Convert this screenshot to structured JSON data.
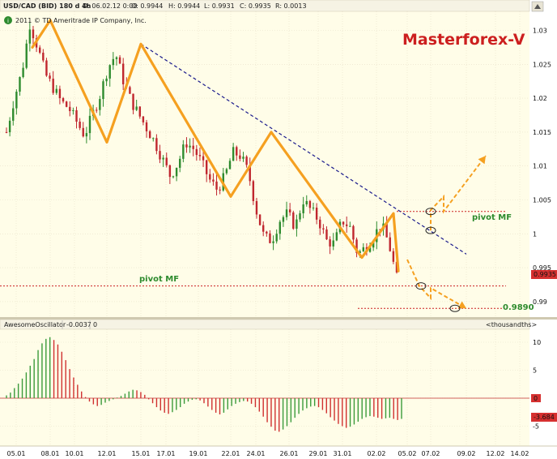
{
  "colors": {
    "background": "#fffde8",
    "grid": "#e6e0c8",
    "up_candle": "#2e8b2e",
    "down_candle": "#c0262e",
    "wave_line": "#f5a020",
    "trend_line": "#1a1a8c",
    "pivot_line": "#cc2020",
    "title_red": "#cc1f1f",
    "ao_green": "#3a9a3a",
    "ao_red": "#d03030"
  },
  "header": {
    "symbol": "USD/CAD (BID) 180 d 4h",
    "date": "D: 06.02.12 0:00",
    "open": "O: 0.9944",
    "high": "H: 0.9944",
    "low": "L: 0.9931",
    "close": "C: 0.9935",
    "range": "R: 0.0013",
    "copyright": "2011 © TD Ameritrade IP Company, Inc."
  },
  "watermark": "Masterforex-V",
  "annotations": {
    "pivot_left": "pivot MF",
    "pivot_right": "pivot MF",
    "target": "0.9890",
    "current_price": "0.9935"
  },
  "oscillator": {
    "name": "AwesomeOscillator",
    "value": "-0.0037",
    "param": "0",
    "units": "<thousandths>",
    "current": "-3.684",
    "zero_label": "0"
  },
  "chart_data": [
    {
      "type": "line",
      "subtype": "candlestick",
      "title": "USD/CAD (BID) 180 d 4h",
      "ylim": [
        0.987,
        1.034
      ],
      "y_ticks": [
        "1.03",
        "1.025",
        "1.02",
        "1.015",
        "1.01",
        "1.005",
        "1",
        "0.995",
        "0.99"
      ],
      "x_ticks": [
        "05.01",
        "08.01",
        "10.01",
        "12.01",
        "15.01",
        "17.01",
        "19.01",
        "22.01",
        "24.01",
        "26.01",
        "29.01",
        "31.01",
        "02.02",
        "05.02",
        "07.02",
        "09.02",
        "12.02",
        "14.02"
      ],
      "close_path": [
        [
          0,
          1.015
        ],
        [
          1,
          1.02
        ],
        [
          2,
          1.024
        ],
        [
          3,
          1.031
        ],
        [
          4,
          1.0275
        ],
        [
          5,
          1.0235
        ],
        [
          6,
          1.0215
        ],
        [
          7,
          1.0195
        ],
        [
          8,
          1.0185
        ],
        [
          9,
          1.0165
        ],
        [
          10,
          1.0145
        ],
        [
          11,
          1.0175
        ],
        [
          12,
          1.0205
        ],
        [
          13,
          1.0245
        ],
        [
          14,
          1.0265
        ],
        [
          15,
          1.0225
        ],
        [
          16,
          1.0195
        ],
        [
          17,
          1.0175
        ],
        [
          18,
          1.0155
        ],
        [
          19,
          1.0135
        ],
        [
          20,
          1.011
        ],
        [
          21,
          1.0085
        ],
        [
          22,
          1.0105
        ],
        [
          23,
          1.0135
        ],
        [
          24,
          1.0125
        ],
        [
          25,
          1.0105
        ],
        [
          26,
          1.008
        ],
        [
          27,
          1.0065
        ],
        [
          28,
          1.0085
        ],
        [
          29,
          1.012
        ],
        [
          30,
          1.0115
        ],
        [
          31,
          1.009
        ],
        [
          32,
          1.0035
        ],
        [
          33,
          0.9995
        ],
        [
          34,
          0.999
        ],
        [
          35,
          1.002
        ],
        [
          36,
          1.003
        ],
        [
          37,
          1.001
        ],
        [
          38,
          1.005
        ],
        [
          39,
          1.0035
        ],
        [
          40,
          1.002
        ],
        [
          41,
          0.999
        ],
        [
          42,
          0.9985
        ],
        [
          43,
          1.002
        ],
        [
          44,
          1.001
        ],
        [
          45,
          0.997
        ],
        [
          46,
          0.998
        ],
        [
          47,
          0.9995
        ],
        [
          48,
          1.0015
        ],
        [
          49,
          0.9985
        ],
        [
          50,
          0.9935
        ]
      ],
      "wave_points": [
        [
          "03.01",
          1.0275
        ],
        [
          "08.01",
          1.0315
        ],
        [
          "12.01",
          1.0135
        ],
        [
          "15.01",
          1.028
        ],
        [
          "22.01",
          1.0055
        ],
        [
          "25.01",
          1.015
        ],
        [
          "01.02",
          0.9965
        ],
        [
          "03.02",
          1.003
        ],
        [
          "03.02",
          0.9945
        ]
      ],
      "trend_line": [
        [
          "15.01",
          1.028
        ],
        [
          "09.02",
          0.997
        ]
      ],
      "pivot_levels": [
        0.9923,
        1.0033
      ],
      "forecast_up": [
        [
          "07.02",
          1.0005
        ],
        [
          "07.02",
          1.0035
        ],
        [
          "08.02",
          1.0055
        ],
        [
          "08.02",
          1.0033
        ],
        [
          "11.02",
          1.0115
        ]
      ],
      "forecast_down": [
        [
          "05.02",
          0.9962
        ],
        [
          "06.02",
          0.9923
        ],
        [
          "07.02",
          0.9905
        ],
        [
          "07.02",
          0.992
        ],
        [
          "09.02",
          0.989
        ]
      ]
    },
    {
      "type": "bar",
      "title": "AwesomeOscillator",
      "ylim": [
        -6,
        12
      ],
      "y_ticks": [
        "10",
        "5",
        "0",
        "-5"
      ],
      "values": [
        0.5,
        1.0,
        1.8,
        2.6,
        3.5,
        4.6,
        5.8,
        7.0,
        8.6,
        9.8,
        10.6,
        10.9,
        10.4,
        9.6,
        8.3,
        6.8,
        5.2,
        3.7,
        2.4,
        1.2,
        0.2,
        -0.6,
        -1.1,
        -1.4,
        -1.2,
        -0.8,
        -0.5,
        -0.2,
        0.1,
        0.4,
        0.8,
        1.2,
        1.5,
        1.4,
        1.1,
        0.6,
        -0.2,
        -0.9,
        -1.6,
        -2.2,
        -2.6,
        -2.8,
        -2.5,
        -2.1,
        -1.6,
        -1.0,
        -0.6,
        -0.3,
        -0.2,
        -0.4,
        -0.9,
        -1.5,
        -2.1,
        -2.6,
        -2.9,
        -2.6,
        -2.0,
        -1.4,
        -1.0,
        -0.7,
        -0.5,
        -0.6,
        -1.0,
        -1.6,
        -2.4,
        -3.3,
        -4.3,
        -5.1,
        -5.8,
        -6.0,
        -5.6,
        -5.0,
        -4.3,
        -3.5,
        -2.8,
        -2.2,
        -1.8,
        -1.5,
        -1.4,
        -1.6,
        -2.1,
        -2.7,
        -3.4,
        -4.0,
        -4.6,
        -5.0,
        -5.3,
        -5.1,
        -4.7,
        -4.2,
        -3.7,
        -3.4,
        -3.2,
        -3.3,
        -3.5,
        -3.7,
        -3.6,
        -3.5,
        -3.7,
        -3.9,
        -3.7
      ]
    }
  ]
}
